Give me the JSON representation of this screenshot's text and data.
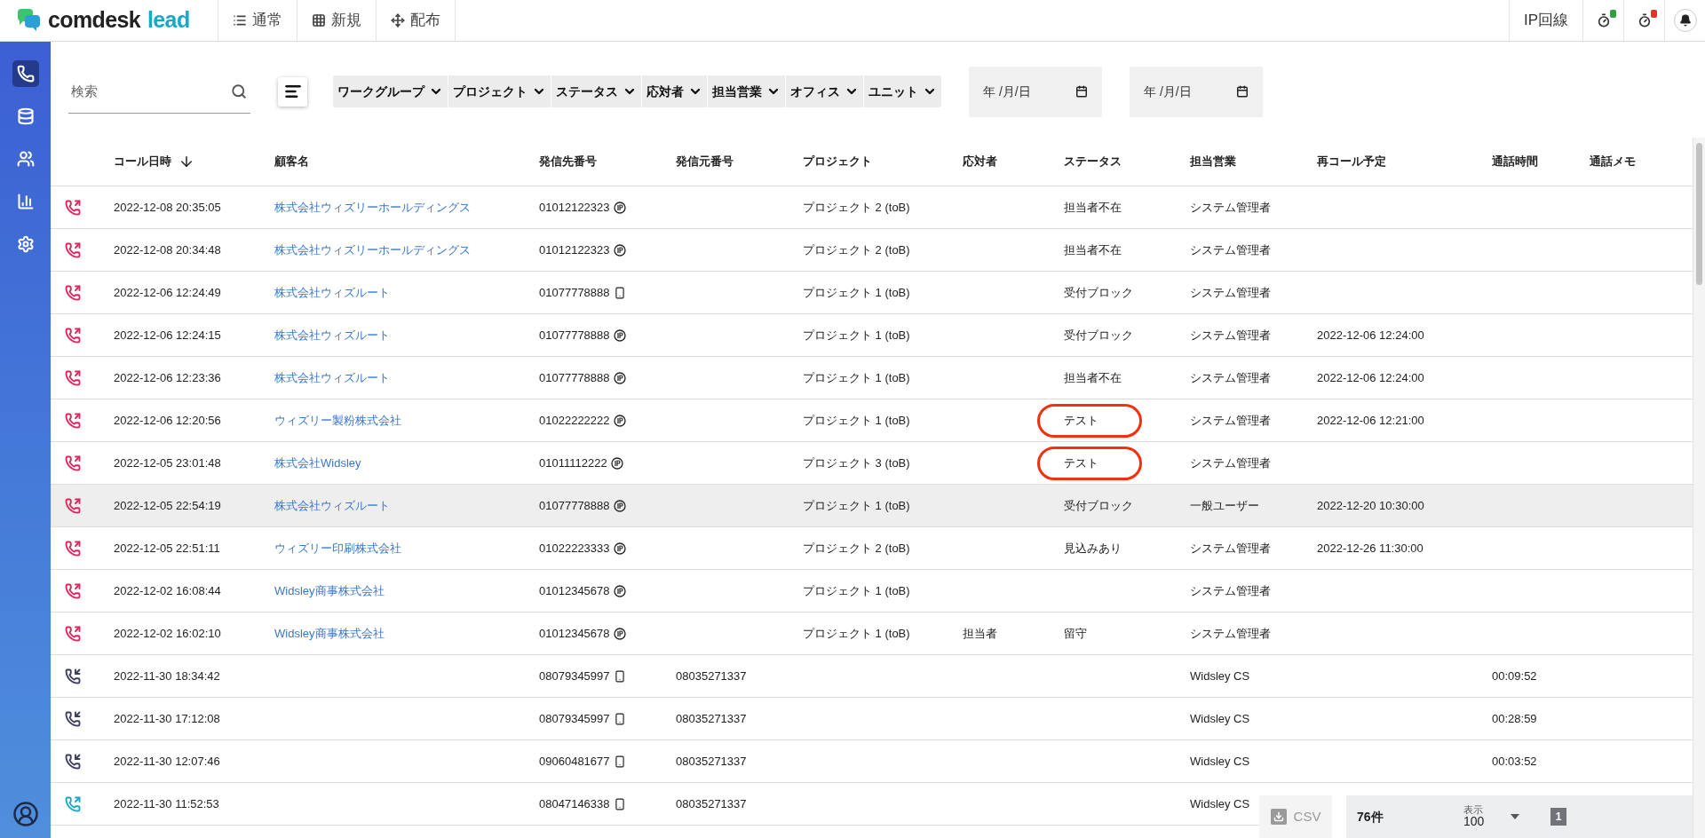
{
  "brand": {
    "name": "comdesk",
    "product": "lead"
  },
  "nav_tabs": [
    {
      "label": "通常"
    },
    {
      "label": "新規"
    },
    {
      "label": "配布"
    }
  ],
  "header_right": {
    "line_label": "IP回線",
    "timers": [
      {
        "color": "#2ea043"
      },
      {
        "color": "#e5322d"
      }
    ]
  },
  "sidebar": {
    "items": [
      {
        "selected": true
      },
      {
        "selected": false
      },
      {
        "selected": false
      },
      {
        "selected": false
      },
      {
        "selected": false
      }
    ]
  },
  "search": {
    "placeholder": "検索"
  },
  "filters": [
    "ワークグループ",
    "プロジェクト",
    "ステータス",
    "応対者",
    "担当営業",
    "オフィス",
    "ユニット"
  ],
  "date_fields": [
    {
      "placeholder": "年 /月/日"
    },
    {
      "placeholder": "年 /月/日"
    }
  ],
  "table": {
    "columns": [
      "コール日時",
      "顧客名",
      "発信先番号",
      "発信元番号",
      "プロジェクト",
      "応対者",
      "ステータス",
      "担当営業",
      "再コール予定",
      "通話時間",
      "通話メモ"
    ],
    "rows": [
      {
        "kind": "outgoing-missed",
        "datetime": "2022-12-08 20:35:05",
        "customer": "株式会社ウィズリーホールディングス",
        "to_number": {
          "number": "01012122323",
          "kind": "ip"
        },
        "project": "プロジェクト 2 (toB)",
        "status": "担当者不在",
        "sales": "システム管理者",
        "circled": false,
        "highlighted": false
      },
      {
        "kind": "outgoing-missed",
        "datetime": "2022-12-08 20:34:48",
        "customer": "株式会社ウィズリーホールディングス",
        "to_number": {
          "number": "01012122323",
          "kind": "ip"
        },
        "project": "プロジェクト 2 (toB)",
        "status": "担当者不在",
        "sales": "システム管理者",
        "circled": false,
        "highlighted": false
      },
      {
        "kind": "outgoing-missed",
        "datetime": "2022-12-06 12:24:49",
        "customer": "株式会社ウィズルート",
        "to_number": {
          "number": "01077778888",
          "kind": "mobile"
        },
        "project": "プロジェクト 1 (toB)",
        "status": "受付ブロック",
        "sales": "システム管理者",
        "circled": false,
        "highlighted": false
      },
      {
        "kind": "outgoing-missed",
        "datetime": "2022-12-06 12:24:15",
        "customer": "株式会社ウィズルート",
        "to_number": {
          "number": "01077778888",
          "kind": "ip"
        },
        "project": "プロジェクト 1 (toB)",
        "status": "受付ブロック",
        "sales": "システム管理者",
        "recall": "2022-12-06 12:24:00",
        "circled": false,
        "highlighted": false
      },
      {
        "kind": "outgoing-missed",
        "datetime": "2022-12-06 12:23:36",
        "customer": "株式会社ウィズルート",
        "to_number": {
          "number": "01077778888",
          "kind": "ip"
        },
        "project": "プロジェクト 1 (toB)",
        "status": "担当者不在",
        "sales": "システム管理者",
        "recall": "2022-12-06 12:24:00",
        "circled": false,
        "highlighted": false
      },
      {
        "kind": "outgoing-missed",
        "datetime": "2022-12-06 12:20:56",
        "customer": "ウィズリー製粉株式会社",
        "to_number": {
          "number": "01022222222",
          "kind": "ip"
        },
        "project": "プロジェクト 1 (toB)",
        "status": "テスト",
        "sales": "システム管理者",
        "recall": "2022-12-06 12:21:00",
        "circled": true,
        "highlighted": false
      },
      {
        "kind": "outgoing-missed",
        "datetime": "2022-12-05 23:01:48",
        "customer": "株式会社Widsley",
        "to_number": {
          "number": "01011112222",
          "kind": "ip"
        },
        "project": "プロジェクト 3 (toB)",
        "status": "テスト",
        "sales": "システム管理者",
        "circled": true,
        "highlighted": false
      },
      {
        "kind": "outgoing-missed",
        "datetime": "2022-12-05 22:54:19",
        "customer": "株式会社ウィズルート",
        "to_number": {
          "number": "01077778888",
          "kind": "ip"
        },
        "project": "プロジェクト 1 (toB)",
        "status": "受付ブロック",
        "sales": "一般ユーザー",
        "recall": "2022-12-20 10:30:00",
        "circled": false,
        "highlighted": true
      },
      {
        "kind": "outgoing-missed",
        "datetime": "2022-12-05 22:51:11",
        "customer": "ウィズリー印刷株式会社",
        "to_number": {
          "number": "01022223333",
          "kind": "ip"
        },
        "project": "プロジェクト 2 (toB)",
        "status": "見込みあり",
        "sales": "システム管理者",
        "recall": "2022-12-26 11:30:00",
        "circled": false,
        "highlighted": false
      },
      {
        "kind": "outgoing-missed",
        "datetime": "2022-12-02 16:08:44",
        "customer": "Widsley商事株式会社",
        "to_number": {
          "number": "01012345678",
          "kind": "ip"
        },
        "project": "プロジェクト 1 (toB)",
        "sales": "システム管理者",
        "circled": false,
        "highlighted": false
      },
      {
        "kind": "outgoing-missed",
        "datetime": "2022-12-02 16:02:10",
        "customer": "Widsley商事株式会社",
        "to_number": {
          "number": "01012345678",
          "kind": "ip"
        },
        "project": "プロジェクト 1 (toB)",
        "responder": "担当者",
        "status": "留守",
        "sales": "システム管理者",
        "circled": false,
        "highlighted": false
      },
      {
        "kind": "incoming",
        "datetime": "2022-11-30 18:34:42",
        "to_number": {
          "number": "08079345997",
          "kind": "mobile"
        },
        "from_number": "08035271337",
        "sales": "Widsley CS",
        "duration": "00:09:52",
        "circled": false,
        "highlighted": false
      },
      {
        "kind": "incoming",
        "datetime": "2022-11-30 17:12:08",
        "to_number": {
          "number": "08079345997",
          "kind": "mobile"
        },
        "from_number": "08035271337",
        "sales": "Widsley CS",
        "duration": "00:28:59",
        "circled": false,
        "highlighted": false
      },
      {
        "kind": "incoming",
        "datetime": "2022-11-30 12:07:46",
        "to_number": {
          "number": "09060481677",
          "kind": "mobile"
        },
        "from_number": "08035271337",
        "sales": "Widsley CS",
        "duration": "00:03:52",
        "circled": false,
        "highlighted": false
      },
      {
        "kind": "outgoing-connected",
        "datetime": "2022-11-30 11:52:53",
        "to_number": {
          "number": "08047146338",
          "kind": "mobile"
        },
        "from_number": "08035271337",
        "sales": "Widsley CS",
        "circled": false,
        "highlighted": false
      }
    ]
  },
  "footer": {
    "csv_label": "CSV",
    "count": "76件",
    "per_page_label": "表示",
    "per_page": "100",
    "pages": [
      {
        "label": "1",
        "selected": true
      }
    ]
  }
}
